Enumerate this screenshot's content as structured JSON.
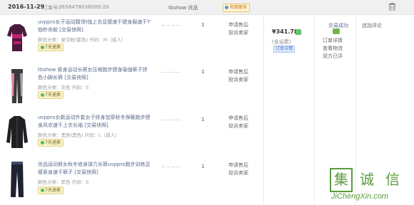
{
  "header": {
    "date": "2016-11-29",
    "order_label": "订单号:",
    "order_number": "2658478036009:20",
    "shop": "tbshow 优品",
    "contact": "和我联系"
  },
  "items": [
    {
      "title": "uvppro女子运动圆领t恤上衣显瘦速干健身服速干T恤秒杀款 [交易快照]",
      "spec": "颜色分类：星空粉(紫色) 尺码：M（成人）",
      "badge": "7天退换",
      "price_placeholder": "————",
      "qty": "1",
      "actions": [
        "申请售后",
        "投诉卖家"
      ]
    },
    {
      "title": "tbshow 紧身运动长裤女压缩跑步健身瑜伽裤子拼色小脚长裤 [交易快照]",
      "spec": "颜色分类：灰色 尺码：S",
      "badge": "7天退换",
      "price_placeholder": "————",
      "qty": "1",
      "actions": [
        "申请售后",
        "投诉卖家"
      ]
    },
    {
      "title": "uvppro女款运动外套女子修身加厚秋冬保暖跑步健身风衣速干上衣长袖 [交易快照]",
      "spec": "颜色分类：黑色(黑色) 尺码：L（成人）",
      "badge": "7天退换",
      "price_placeholder": "————",
      "qty": "1",
      "actions": [
        "申请售后",
        "投诉卖家"
      ]
    },
    {
      "title": "优品运动裤女秋冬修身弹力长裤uvppro跑步训练显瘦紧身速干裤子 [交易快照]",
      "spec": "颜色分类：黑色 尺码：S",
      "badge": "7天退换",
      "price_placeholder": "————",
      "qty": "1",
      "actions": [
        "申请售后",
        "投诉卖家"
      ]
    }
  ],
  "order": {
    "total": "¥341.78",
    "shipping": "(含运费)",
    "detail": "订单详情"
  },
  "status": {
    "label": "交易成功",
    "lines": [
      "订单详情",
      "查看物流",
      "双方已评"
    ]
  },
  "evaluation": "追加评论",
  "watermark": {
    "chars": [
      "集",
      "诚",
      "信"
    ],
    "url": "JiChengXin.com",
    "color": "#5a9b3c"
  },
  "colors": {
    "link": "#5a6a8a",
    "badge_bg": "#f6f0c8"
  }
}
